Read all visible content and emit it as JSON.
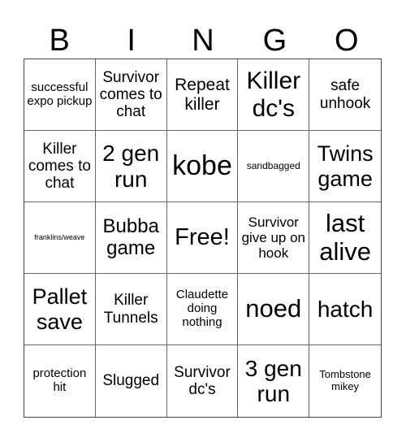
{
  "header": [
    "B",
    "I",
    "N",
    "G",
    "O"
  ],
  "cells": [
    {
      "text": "successful expo pickup",
      "size": 15
    },
    {
      "text": "Survivor comes to chat",
      "size": 19
    },
    {
      "text": "Repeat killer",
      "size": 21
    },
    {
      "text": "Killer dc's",
      "size": 30
    },
    {
      "text": "safe unhook",
      "size": 19
    },
    {
      "text": "Killer comes to chat",
      "size": 19
    },
    {
      "text": "2 gen run",
      "size": 28
    },
    {
      "text": "kobe",
      "size": 34
    },
    {
      "text": "sandbagged",
      "size": 12
    },
    {
      "text": "Twins game",
      "size": 27
    },
    {
      "text": "franklins/weave",
      "size": 9
    },
    {
      "text": "Bubba game",
      "size": 24
    },
    {
      "text": "Free!",
      "size": 29
    },
    {
      "text": "Survivor give up on hook",
      "size": 17
    },
    {
      "text": "last alive",
      "size": 31
    },
    {
      "text": "Pallet save",
      "size": 27
    },
    {
      "text": "Killer Tunnels",
      "size": 19
    },
    {
      "text": "Claudette doing nothing",
      "size": 15
    },
    {
      "text": "noed",
      "size": 31
    },
    {
      "text": "hatch",
      "size": 28
    },
    {
      "text": "protection hit",
      "size": 15
    },
    {
      "text": "Slugged",
      "size": 19
    },
    {
      "text": "Survivor dc's",
      "size": 19
    },
    {
      "text": "3 gen run",
      "size": 28
    },
    {
      "text": "Tombstone mikey",
      "size": 13
    }
  ]
}
